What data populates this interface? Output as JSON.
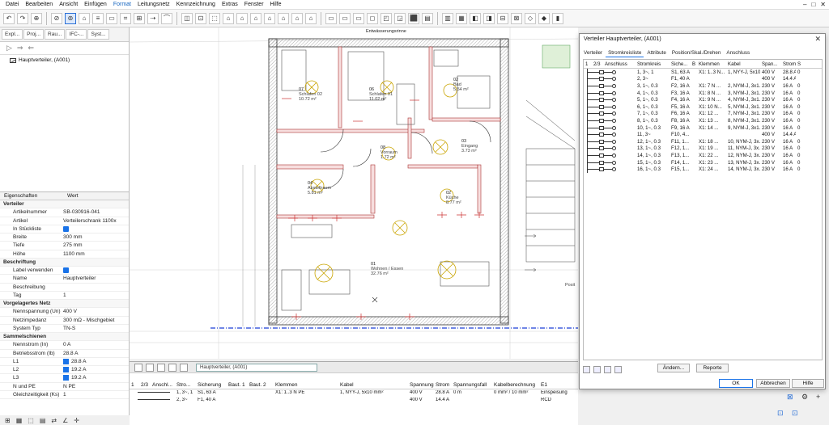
{
  "menu": [
    "Datei",
    "Bearbeiten",
    "Ansicht",
    "Einfügen",
    "Format",
    "Leitungsnetz",
    "Kennzeichnung",
    "Extras",
    "Fenster",
    "Hilfe"
  ],
  "menu_active": "Format",
  "panel_tabs": [
    "Expl...",
    "Proj...",
    "Rau...",
    "IFC-...",
    "Syst..."
  ],
  "tree": {
    "item": "Hauptverteiler, (A001)"
  },
  "props_header": {
    "k": "Eigenschaften",
    "v": "Wert"
  },
  "props": [
    {
      "k": "Verteiler",
      "cat": true
    },
    {
      "k": "Artikelnummer",
      "v": "SB-030916-041"
    },
    {
      "k": "Artikel",
      "v": "Verteilerschrank 1100x"
    },
    {
      "k": "In Stückliste",
      "chk": true
    },
    {
      "k": "Breite",
      "v": "300 mm"
    },
    {
      "k": "Tiefe",
      "v": "275 mm"
    },
    {
      "k": "Höhe",
      "v": "1100 mm"
    },
    {
      "k": "Beschriftung",
      "cat": true
    },
    {
      "k": "Label verwenden",
      "chk": true
    },
    {
      "k": "Name",
      "v": "Hauptverteiler"
    },
    {
      "k": "Beschreibung",
      "v": ""
    },
    {
      "k": "Tag",
      "v": "1"
    },
    {
      "k": "Vorgelagertes Netz",
      "cat": true
    },
    {
      "k": "Nennspannung (Un)",
      "v": "400 V"
    },
    {
      "k": "Netzimpedanz",
      "v": "300 mΩ - Mischgebiet"
    },
    {
      "k": "System Typ",
      "v": "TN-S"
    },
    {
      "k": "Sammelschienen",
      "cat": true
    },
    {
      "k": "Nennstrom (In)",
      "v": "0 A"
    },
    {
      "k": "Betriebsstrom (Ib)",
      "v": "28.8 A"
    },
    {
      "k": "L1",
      "v": "28.8 A",
      "sw": true
    },
    {
      "k": "L2",
      "v": "19.2 A",
      "sw": true
    },
    {
      "k": "L3",
      "v": "19.2 A",
      "sw": true
    },
    {
      "k": "N und PE",
      "v": "N PE"
    },
    {
      "k": "Gleichzeitigkeit (Ks)",
      "v": "1"
    }
  ],
  "rooms": [
    {
      "no": "07",
      "name": "Schlafen 02",
      "area": "10.72 m²"
    },
    {
      "no": "06",
      "name": "Schlafen 01",
      "area": "11.02 m²"
    },
    {
      "no": "02",
      "name": "Bad",
      "area": "5.54 m²"
    },
    {
      "no": "03",
      "name": "Eingang",
      "area": "3.73 m²"
    },
    {
      "no": "08",
      "name": "Vorraum",
      "area": "1.72 m²"
    },
    {
      "no": "04",
      "name": "Abstellraum",
      "area": "5.81 m²"
    },
    {
      "no": "02",
      "name": "Küche",
      "area": "8.77 m²"
    },
    {
      "no": "01",
      "name": "Wohnen / Essen",
      "area": "32.76 m²"
    }
  ],
  "cad_small": {
    "top": "Entwässerungsrinne",
    "pos": "Posit"
  },
  "bottom": {
    "selector": "Hauptverteiler, (A001)",
    "headers": [
      "1",
      "2/3",
      "Anschl...",
      "Stro...",
      "Sicherung",
      "Baut. 1",
      "Baut. 2",
      "Klemmen",
      "Kabel",
      "Spannung",
      "Strom",
      "Spannungsfall",
      "Kabelberechnung",
      "E1"
    ],
    "rows": [
      [
        "1, 3~, 1",
        "S1, 63 A",
        "",
        "",
        "X1: 1..3 N PE",
        "1, NYY-J, 5x10 mm²",
        "400 V",
        "28.8 A",
        "0 m",
        "0 mm² / 10 mm²",
        "Einspeisung"
      ],
      [
        "2, 3~",
        "F1, 40 A",
        "",
        "",
        "",
        "",
        "400 V",
        "14.4 A",
        "",
        "",
        "RCD"
      ]
    ]
  },
  "dialog": {
    "title": "Verteiler Hauptverteiler, (A001)",
    "tabs": [
      "Verteiler",
      "Stromkreisliste",
      "Attribute",
      "Position/Skal./Drehen",
      "Anschluss"
    ],
    "active_tab": "Stromkreisliste",
    "headers": [
      "1",
      "2/3",
      "Anschluss",
      "Stromkreis",
      "Siche...",
      "B",
      "Klemmen",
      "Kabel",
      "Span...",
      "Strom",
      "S"
    ],
    "rows": [
      {
        "sk": "1, 3~, 1",
        "si": "S1, 63 A",
        "kl": "X1: 1..3 N...",
        "ka": "1, NYY-J, 5x10...",
        "sp": "400 V",
        "st": "28.8 A",
        "s": "0"
      },
      {
        "sk": "2, 3~",
        "si": "F1, 40 A",
        "kl": "",
        "ka": "",
        "sp": "400 V",
        "st": "14.4 A",
        "s": ""
      },
      {
        "sk": "3, 1~, 0.3",
        "si": "F2, 16 A",
        "kl": "X1: 7 N ...",
        "ka": "2, NYM-J, 3x1...",
        "sp": "230 V",
        "st": "16 A",
        "s": "0"
      },
      {
        "sk": "4, 1~, 0.3",
        "si": "F3, 16 A",
        "kl": "X1: 8 N ...",
        "ka": "3, NYM-J, 3x1...",
        "sp": "230 V",
        "st": "16 A",
        "s": "0"
      },
      {
        "sk": "5, 1~, 0.3",
        "si": "F4, 16 A",
        "kl": "X1: 9 N ...",
        "ka": "4, NYM-J, 3x1...",
        "sp": "230 V",
        "st": "16 A",
        "s": "0"
      },
      {
        "sk": "6, 1~, 0.3",
        "si": "F5, 16 A",
        "kl": "X1: 10 N...",
        "ka": "5, NYM-J, 3x1...",
        "sp": "230 V",
        "st": "16 A",
        "s": "0"
      },
      {
        "sk": "7, 1~, 0.3",
        "si": "F6, 16 A",
        "kl": "X1: 12 ...",
        "ka": "7, NYM-J, 3x1...",
        "sp": "230 V",
        "st": "16 A",
        "s": "0"
      },
      {
        "sk": "8, 1~, 0.3",
        "si": "F8, 16 A",
        "kl": "X1: 13 ...",
        "ka": "8, NYM-J, 3x1...",
        "sp": "230 V",
        "st": "16 A",
        "s": "0"
      },
      {
        "sk": "10, 1~, 0.3",
        "si": "F9, 16 A",
        "kl": "X1: 14 ...",
        "ka": "9, NYM-J, 3x1...",
        "sp": "230 V",
        "st": "16 A",
        "s": "0"
      },
      {
        "sk": "11, 3~",
        "si": "F10, 4...",
        "kl": "",
        "ka": "",
        "sp": "400 V",
        "st": "14.4 A",
        "s": ""
      },
      {
        "sk": "12, 1~, 0.3",
        "si": "F11, 1...",
        "kl": "X1: 18 ...",
        "ka": "10, NYM-J, 3x...",
        "sp": "230 V",
        "st": "16 A",
        "s": "0"
      },
      {
        "sk": "13, 1~, 0.3",
        "si": "F12, 1...",
        "kl": "X1: 19 ...",
        "ka": "11, NYM-J, 3x...",
        "sp": "230 V",
        "st": "16 A",
        "s": "0"
      },
      {
        "sk": "14, 1~, 0.3",
        "si": "F13, 1...",
        "kl": "X1: 22 ...",
        "ka": "12, NYM-J, 3x...",
        "sp": "230 V",
        "st": "16 A",
        "s": "0"
      },
      {
        "sk": "15, 1~, 0.3",
        "si": "F14, 1...",
        "kl": "X1: 23 ...",
        "ka": "13, NYM-J, 3x...",
        "sp": "230 V",
        "st": "16 A",
        "s": "0"
      },
      {
        "sk": "16, 1~, 0.3",
        "si": "F15, 1...",
        "kl": "X1: 24 ...",
        "ka": "14, NYM-J, 3x...",
        "sp": "230 V",
        "st": "16 A",
        "s": "0"
      }
    ],
    "btn_change": "Ändern...",
    "btn_report": "Reporte",
    "ok": "OK",
    "cancel": "Abbrechen",
    "help": "Hilfe"
  }
}
